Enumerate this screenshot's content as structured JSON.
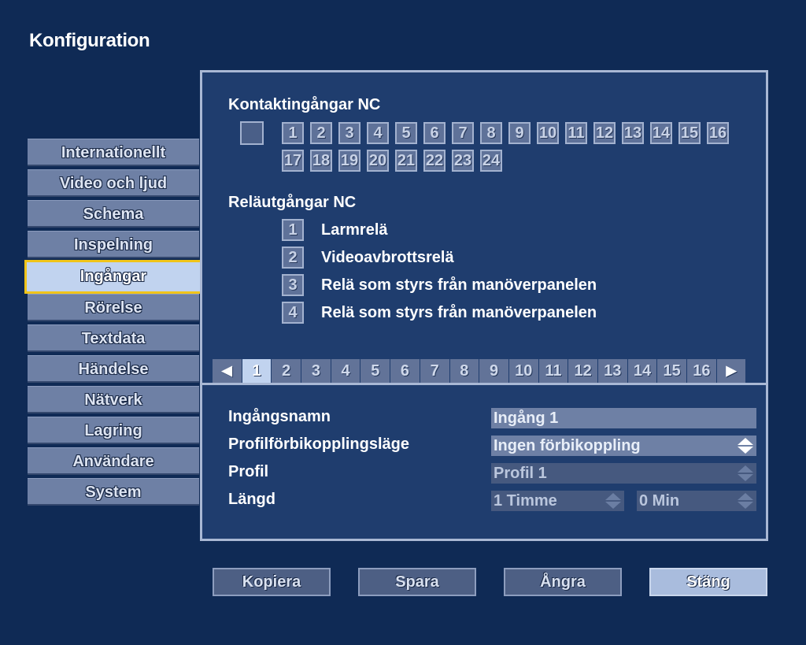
{
  "window": {
    "title": "Konfiguration"
  },
  "sidebar": {
    "items": [
      {
        "label": "Internationellt"
      },
      {
        "label": "Video och ljud"
      },
      {
        "label": "Schema"
      },
      {
        "label": "Inspelning"
      },
      {
        "label": "Ingångar"
      },
      {
        "label": "Rörelse"
      },
      {
        "label": "Textdata"
      },
      {
        "label": "Händelse"
      },
      {
        "label": "Nätverk"
      },
      {
        "label": "Lagring"
      },
      {
        "label": "Användare"
      },
      {
        "label": "System"
      }
    ],
    "active": "Ingångar"
  },
  "inputs": {
    "heading": "Kontaktingångar NC",
    "numbers": [
      "1",
      "2",
      "3",
      "4",
      "5",
      "6",
      "7",
      "8",
      "9",
      "10",
      "11",
      "12",
      "13",
      "14",
      "15",
      "16",
      "17",
      "18",
      "19",
      "20",
      "21",
      "22",
      "23",
      "24"
    ]
  },
  "relays": {
    "heading": "Reläutgångar NC",
    "items": [
      {
        "number": "1",
        "label": "Larmrelä"
      },
      {
        "number": "2",
        "label": "Videoavbrottsrelä"
      },
      {
        "number": "3",
        "label": "Relä som styrs från manöverpanelen"
      },
      {
        "number": "4",
        "label": "Relä som styrs från manöverpanelen"
      }
    ]
  },
  "tabs": {
    "prev_icon": "◀",
    "next_icon": "▶",
    "items": [
      "1",
      "2",
      "3",
      "4",
      "5",
      "6",
      "7",
      "8",
      "9",
      "10",
      "11",
      "12",
      "13",
      "14",
      "15",
      "16"
    ],
    "active": "1"
  },
  "form": {
    "name_label": "Ingångsnamn",
    "name_value": "Ingång 1",
    "bypass_label": "Profilförbikopplingsläge",
    "bypass_value": "Ingen förbikoppling",
    "profile_label": "Profil",
    "profile_value": "Profil 1",
    "length_label": "Längd",
    "length_hours": "1 Timme",
    "length_minutes": "0 Min"
  },
  "buttons": {
    "copy": "Kopiera",
    "save": "Spara",
    "undo": "Ångra",
    "close": "Stäng"
  },
  "icons": {
    "spin": "up-down-spinner-icon",
    "prev": "triangle-left-icon",
    "next": "triangle-right-icon"
  }
}
